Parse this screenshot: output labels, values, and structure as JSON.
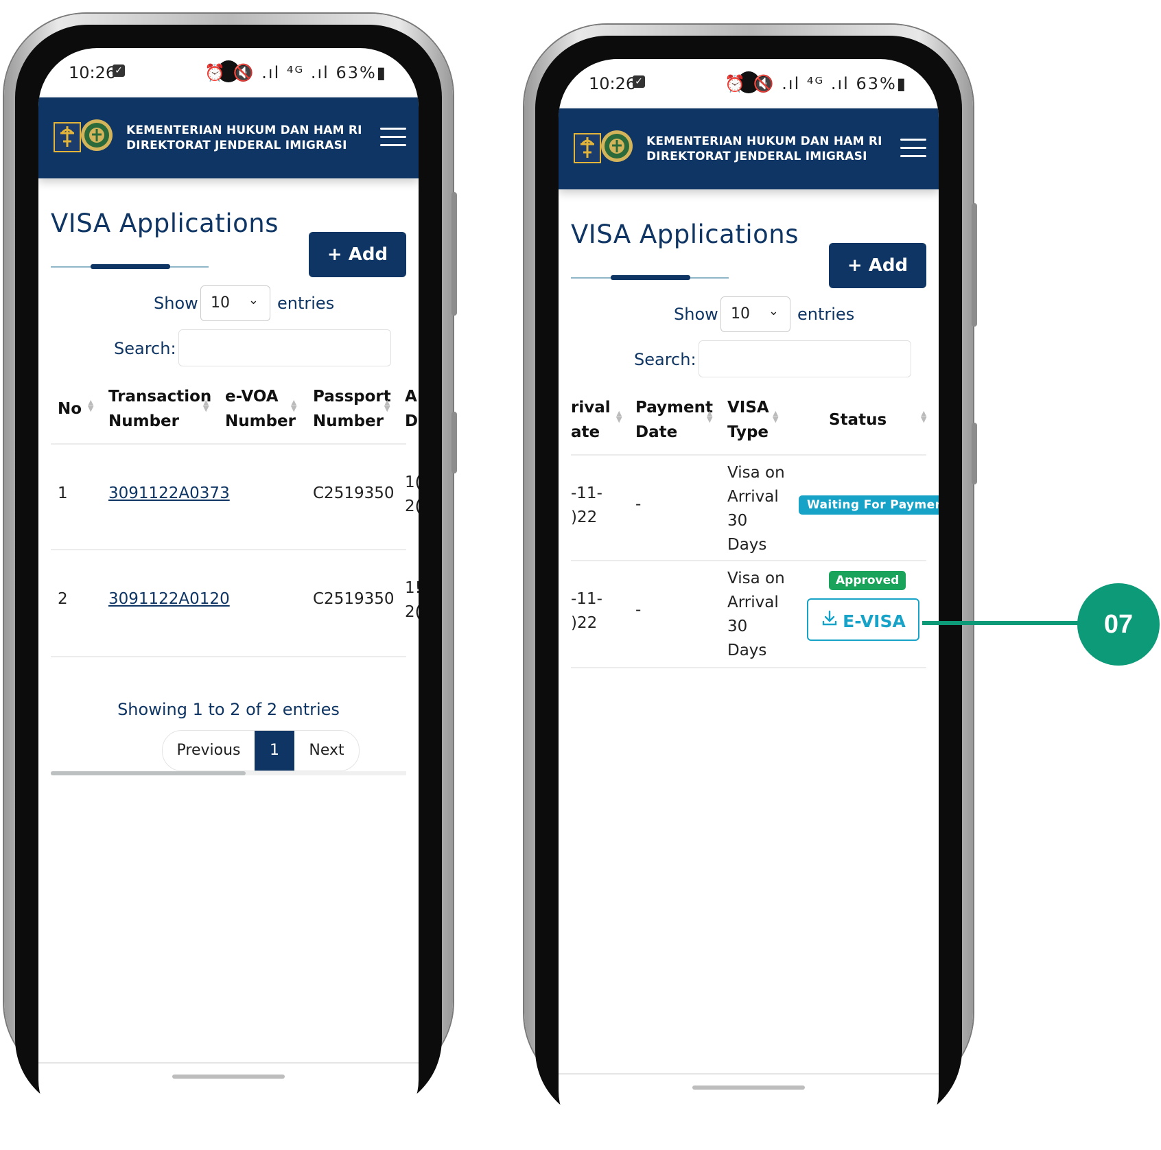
{
  "status_bar": {
    "time": "10:26",
    "icons": "⏰ 🔇 .ıl ⁴ᴳ .ıl 63%▮"
  },
  "header": {
    "org_line1": "KEMENTERIAN HUKUM DAN HAM RI",
    "org_line2": "DIREKTORAT JENDERAL IMIGRASI"
  },
  "page": {
    "title": "VISA Applications",
    "add_label": "+ Add",
    "show_label": "Show",
    "entries_value": "10",
    "entries_label": "entries",
    "search_label": "Search:",
    "search_value": ""
  },
  "left_table": {
    "headers": [
      {
        "l1": "No",
        "l2": ""
      },
      {
        "l1": "Transaction",
        "l2": "Number"
      },
      {
        "l1": "e-VOA",
        "l2": "Number"
      },
      {
        "l1": "Passport",
        "l2": "Number"
      },
      {
        "l1": "A",
        "l2": "D"
      }
    ],
    "rows": [
      {
        "no": "1",
        "transaction": "3091122A0373",
        "evoa": "",
        "passport": "C2519350",
        "arrival_l1": "1(",
        "arrival_l2": "2("
      },
      {
        "no": "2",
        "transaction": "3091122A0120",
        "evoa": "",
        "passport": "C2519350",
        "arrival_l1": "1!",
        "arrival_l2": "2("
      }
    ],
    "info": "Showing 1 to 2 of 2 entries",
    "prev": "Previous",
    "page": "1",
    "next": "Next"
  },
  "right_table": {
    "headers": [
      {
        "l1": "rival",
        "l2": "ate"
      },
      {
        "l1": "Payment",
        "l2": "Date"
      },
      {
        "l1": "VISA",
        "l2": "Type"
      },
      {
        "l1": "Status",
        "l2": ""
      }
    ],
    "rows": [
      {
        "arrival_l1": "-11-",
        "arrival_l2": ")22",
        "payment": "-",
        "visa_l1": "Visa on",
        "visa_l2": "Arrival",
        "visa_l3": "30",
        "visa_l4": "Days",
        "status": "Waiting For Payment"
      },
      {
        "arrival_l1": "-11-",
        "arrival_l2": ")22",
        "payment": "-",
        "visa_l1": "Visa on",
        "visa_l2": "Arrival",
        "visa_l3": "30",
        "visa_l4": "Days",
        "status": "Approved",
        "action": "E-VISA"
      }
    ]
  },
  "callout": {
    "label": "07"
  },
  "colors": {
    "navy": "#0e3563",
    "teal": "#17a2c7",
    "green": "#1aa35a",
    "callout": "#0d9a78"
  }
}
